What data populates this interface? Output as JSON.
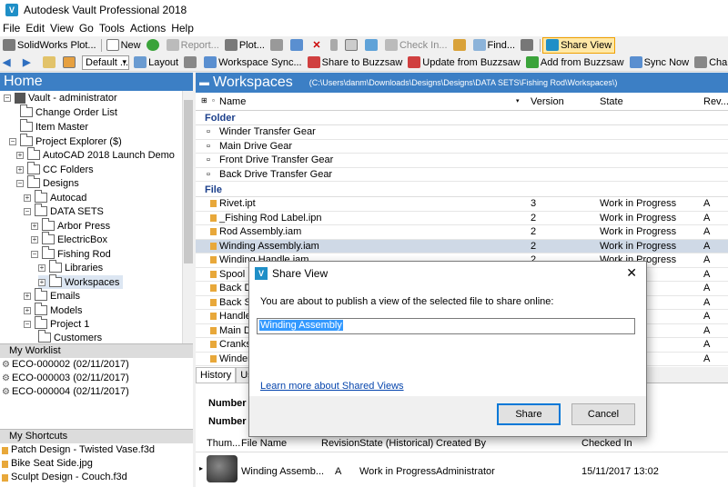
{
  "window": {
    "title": "Autodesk Vault Professional 2018"
  },
  "menu": [
    "File",
    "Edit",
    "View",
    "Go",
    "Tools",
    "Actions",
    "Help"
  ],
  "toolbar1": {
    "solidworks_plot": "SolidWorks Plot...",
    "new": "New",
    "report": "Report...",
    "plot": "Plot...",
    "check_in": "Check In...",
    "find": "Find...",
    "share_view": "Share View"
  },
  "toolbar2": {
    "layout_combo": "Default ...",
    "layout": "Layout",
    "workspace_sync": "Workspace Sync...",
    "share_buzzsaw": "Share to Buzzsaw",
    "update_buzzsaw": "Update from Buzzsaw",
    "add_buzzsaw": "Add from Buzzsaw",
    "sync_now": "Sync Now",
    "change_category": "Change Catego"
  },
  "nav": {
    "home": "Home",
    "tree": [
      "Vault - administrator",
      "Change Order List",
      "Item Master",
      "Project Explorer ($)",
      "AutoCAD 2018 Launch Demo",
      "CC Folders",
      "Designs",
      "Autocad",
      "DATA SETS",
      "Arbor Press",
      "ElectricBox",
      "Fishing Rod",
      "Libraries",
      "Workspaces",
      "Emails",
      "Models",
      "Project 1",
      "Customers"
    ]
  },
  "worklist": {
    "title": "My Worklist",
    "items": [
      "ECO-000002 (02/11/2017)",
      "ECO-000003 (02/11/2017)",
      "ECO-000004 (02/11/2017)"
    ]
  },
  "shortcuts": {
    "title": "My Shortcuts",
    "items": [
      "Patch Design - Twisted Vase.f3d",
      "Bike Seat Side.jpg",
      "Sculpt Design - Couch.f3d"
    ]
  },
  "workspace": {
    "title": "Workspaces",
    "path": "(C:\\Users\\danm\\Downloads\\Designs\\Designs\\DATA SETS\\Fishing Rod\\Workspaces\\)",
    "columns": {
      "name": "Name",
      "version": "Version",
      "state": "State",
      "revision": "Rev..."
    },
    "groups": {
      "folder": "Folder",
      "file": "File"
    },
    "folders": [
      "Winder Transfer Gear",
      "Main Drive Gear",
      "Front Drive Transfer Gear",
      "Back Drive Transfer Gear"
    ],
    "files": [
      {
        "name": "Rivet.ipt",
        "version": "3",
        "state": "Work in Progress",
        "rev": "A"
      },
      {
        "name": "_Fishing Rod Label.ipn",
        "version": "2",
        "state": "Work in Progress",
        "rev": "A"
      },
      {
        "name": "Rod Assembly.iam",
        "version": "2",
        "state": "Work in Progress",
        "rev": "A"
      },
      {
        "name": "Winding Assembly.iam",
        "version": "2",
        "state": "Work in Progress",
        "rev": "A"
      },
      {
        "name": "Winding Handle.iam",
        "version": "2",
        "state": "Work in Progress",
        "rev": "A"
      },
      {
        "name": "Spool",
        "version": "",
        "state": "",
        "rev": "A"
      },
      {
        "name": "Back D",
        "version": "",
        "state": "",
        "rev": "A"
      },
      {
        "name": "Back S",
        "version": "",
        "state": "",
        "rev": "A"
      },
      {
        "name": "Handle",
        "version": "",
        "state": "",
        "rev": "A"
      },
      {
        "name": "Main D",
        "version": "",
        "state": "",
        "rev": "A"
      },
      {
        "name": "Cranks",
        "version": "",
        "state": "",
        "rev": "A"
      },
      {
        "name": "Winder",
        "version": "",
        "state": "",
        "rev": "A"
      }
    ]
  },
  "bottom": {
    "tab_history": "History",
    "tab_uses": "Us",
    "number1": "Number",
    "number2": "Number",
    "columns": {
      "thumb": "Thum...",
      "file_name": "File Name",
      "revision": "Revision",
      "state": "State (Historical)",
      "created_by": "Created By",
      "checked_in": "Checked In"
    },
    "row": {
      "file_name": "Winding Assemb...",
      "revision": "A",
      "state": "Work in Progress",
      "created_by": "Administrator",
      "checked_in": "15/11/2017 13:02"
    }
  },
  "dialog": {
    "title": "Share View",
    "message": "You are about to publish a view of the selected file to share online:",
    "input_value": "Winding Assembly",
    "link": "Learn more about Shared Views",
    "share": "Share",
    "cancel": "Cancel"
  }
}
